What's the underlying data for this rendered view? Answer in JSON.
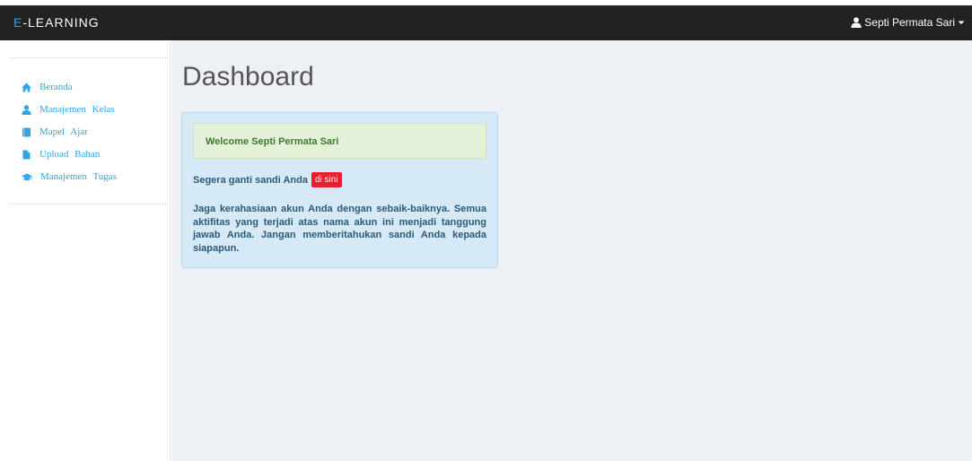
{
  "navbar": {
    "brand_prefix": "E",
    "brand_suffix": "-LEARNING",
    "user_name": "Septi Permata Sari",
    "colors": {
      "bar": "#222222",
      "accent": "#2fa4e7"
    }
  },
  "sidebar": {
    "items": [
      {
        "label": "Beranda",
        "icon": "home-icon"
      },
      {
        "label": "Manajemen Kelas",
        "icon": "user-icon"
      },
      {
        "label": "Mapel Ajar",
        "icon": "book-icon"
      },
      {
        "label": "Upload Bahan",
        "icon": "file-icon"
      },
      {
        "label": "Manajemen Tugas",
        "icon": "graduation-cap-icon"
      }
    ]
  },
  "main": {
    "title": "Dashboard",
    "welcome": "Welcome Septi Permata Sari",
    "password_prompt": "Segera ganti sandi Anda",
    "password_link": "di sini",
    "note": "Jaga kerahasiaan akun Anda dengan sebaik-baiknya. Semua aktifitas yang terjadi atas nama akun ini menjadi tanggung jawab Anda. Jangan memberitahukan sandi Anda kepada siapapun."
  }
}
